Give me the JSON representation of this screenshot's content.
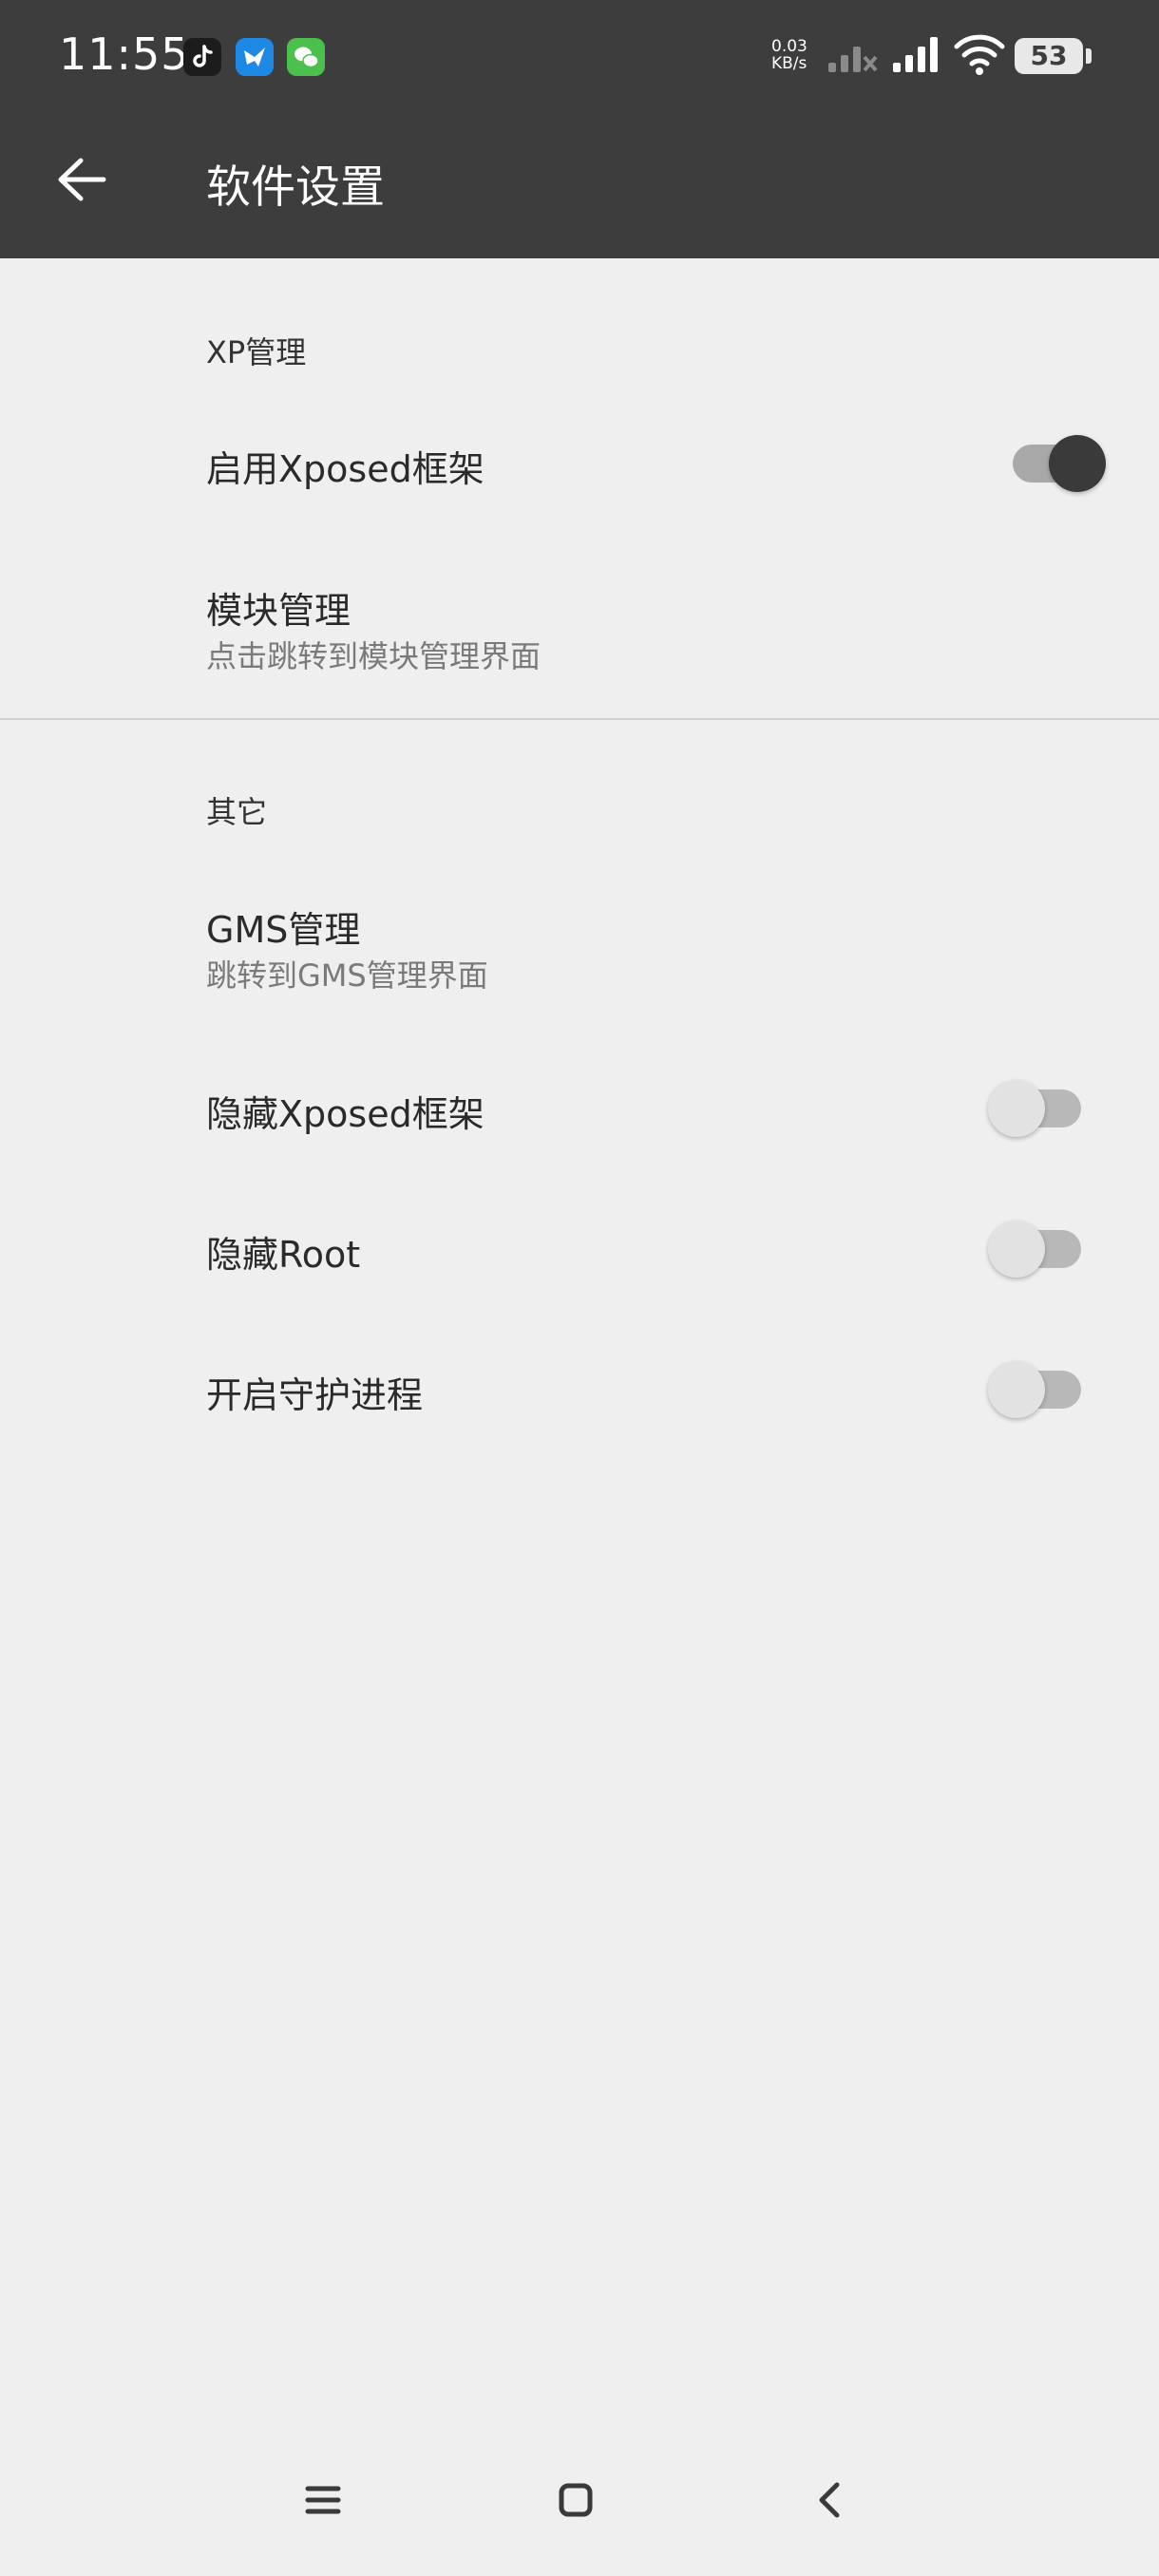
{
  "status_bar": {
    "time": "11:55",
    "net_speed_value": "0.03",
    "net_speed_unit": "KB/s",
    "battery": "53",
    "app_icons": [
      "tiktok-icon",
      "bird-icon",
      "wechat-icon"
    ]
  },
  "header": {
    "title": "软件设置"
  },
  "sections": {
    "xp": {
      "header": "XP管理",
      "enable_xposed": {
        "title": "启用Xposed框架",
        "enabled": true
      },
      "module_manage": {
        "title": "模块管理",
        "subtitle": "点击跳转到模块管理界面"
      }
    },
    "other": {
      "header": "其它",
      "gms": {
        "title": "GMS管理",
        "subtitle": "跳转到GMS管理界面"
      },
      "hide_xposed": {
        "title": "隐藏Xposed框架",
        "enabled": false
      },
      "hide_root": {
        "title": "隐藏Root",
        "enabled": false
      },
      "daemon": {
        "title": "开启守护进程",
        "enabled": false
      }
    }
  },
  "colors": {
    "header_bg": "#3d3d3d",
    "page_bg": "#efefef",
    "switch_on_knob": "#3a3a3a",
    "switch_off_knob": "#e2e2e2"
  }
}
